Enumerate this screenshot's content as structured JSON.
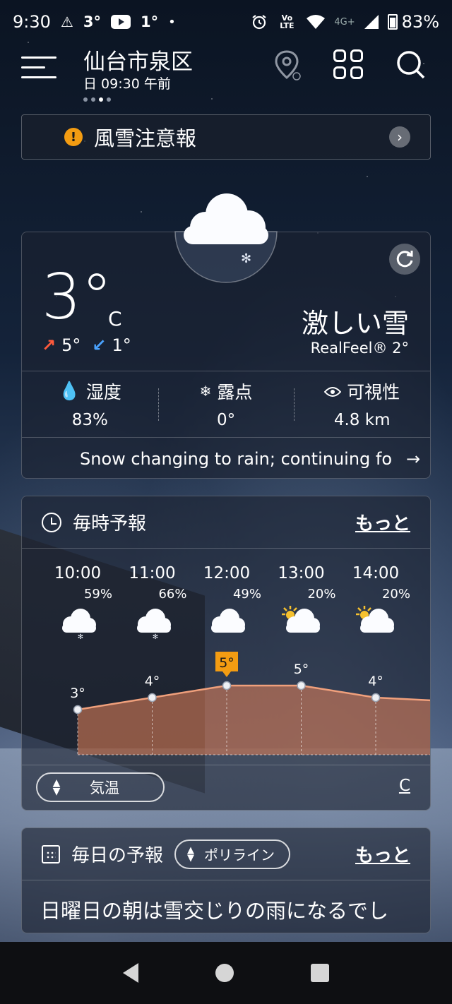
{
  "status_bar": {
    "time": "9:30",
    "temp_a": "3°",
    "temp_b": "1°",
    "dot": "•",
    "lte": "Vo LTE",
    "network": "4G+",
    "battery": "83%"
  },
  "header": {
    "location": "仙台市泉区",
    "datetime": "日 09:30 午前"
  },
  "alert": {
    "icon": "!",
    "text": "風雪注意報"
  },
  "current": {
    "temperature": "3°",
    "unit": "C",
    "high": "5°",
    "low": "1°",
    "condition": "激しい雪",
    "realfeel": "RealFeel® 2°",
    "metrics": [
      {
        "label": "湿度",
        "value": "83%",
        "icon": "drop-icon"
      },
      {
        "label": "露点",
        "value": "0°",
        "icon": "dewpoint-icon"
      },
      {
        "label": "可視性",
        "value": "4.8 km",
        "icon": "eye-icon"
      }
    ],
    "summary": "Snow changing to rain; continuing fo"
  },
  "hourly": {
    "title": "毎時予報",
    "more": "もっと",
    "hours": [
      {
        "time": "10:00",
        "precip": "59%",
        "temp": "3°",
        "temp_value": 3,
        "icon": "snow-cloud-icon"
      },
      {
        "time": "11:00",
        "precip": "66%",
        "temp": "4°",
        "temp_value": 4,
        "icon": "snow-cloud-icon"
      },
      {
        "time": "12:00",
        "precip": "49%",
        "temp": "5°",
        "temp_value": 5,
        "icon": "cloud-icon",
        "highlight": true
      },
      {
        "time": "13:00",
        "precip": "20%",
        "temp": "5°",
        "temp_value": 5,
        "icon": "partly-sunny-icon"
      },
      {
        "time": "14:00",
        "precip": "20%",
        "temp": "4°",
        "temp_value": 4,
        "icon": "partly-sunny-icon"
      }
    ],
    "selector_label": "気温",
    "unit": "C"
  },
  "daily": {
    "title": "毎日の予報",
    "selector": "ポリライン",
    "more": "もっと",
    "text": "日曜日の朝は雪交じりの雨になるでし"
  },
  "colors": {
    "alert": "#f39c12",
    "high_arrow": "#ff5a3c",
    "low_arrow": "#4aa3ff",
    "temp_fill": "#e8845a",
    "highlight": "#f39c12"
  }
}
